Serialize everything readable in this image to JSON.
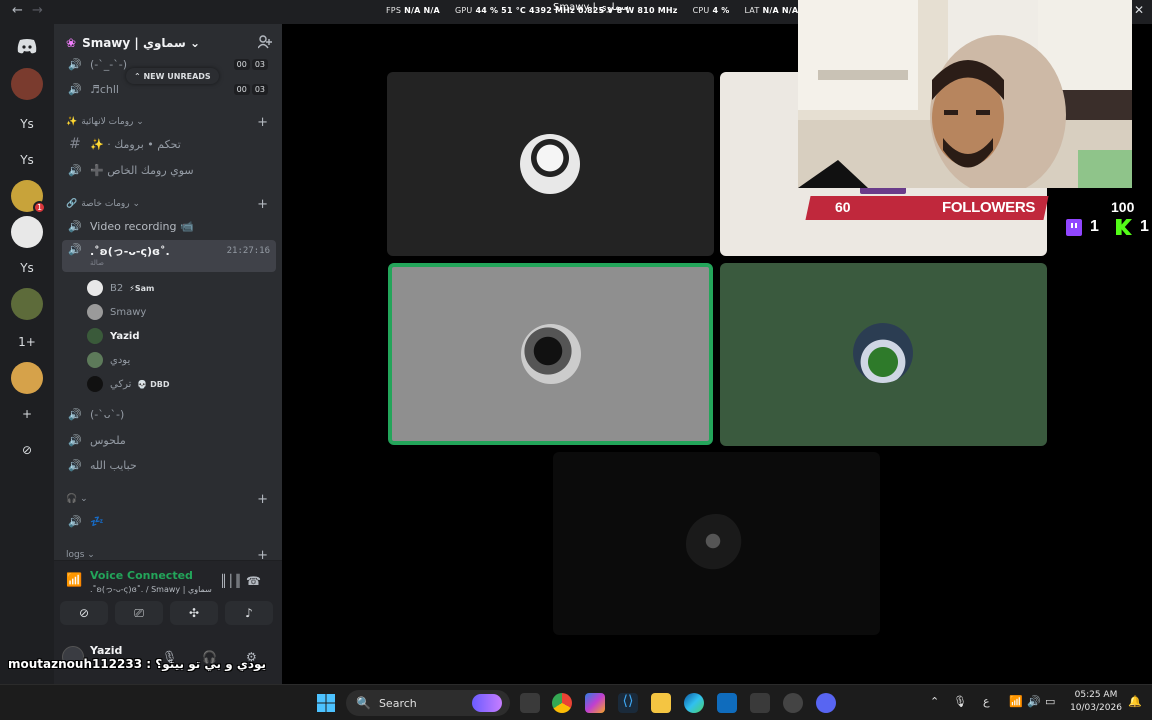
{
  "overlay": {
    "fps_label": "FPS",
    "fps_value": "N/A",
    "fps_value2": "N/A",
    "gpu_label": "GPU",
    "gpu_load": "44 %",
    "gpu_temp": "51 °C",
    "gpu_clock": "4392 MHz",
    "gpu_volt": "0.825 V",
    "gpu_power": "8 W",
    "gpu_mem": "810 MHz",
    "cpu_label": "CPU",
    "cpu_load": "4 %",
    "lat_label": "LAT",
    "lat_value": "N/A",
    "lat_value2": "N/A"
  },
  "window": {
    "title": "Smawy | سماوي",
    "back": "←",
    "forward": "→",
    "close": "✕"
  },
  "rail": {
    "home": "discord-logo",
    "items": [
      {
        "label": "",
        "kind": "avatar",
        "color": "#7a3b2e"
      },
      {
        "label": "Ys"
      },
      {
        "label": "Ys"
      },
      {
        "label": "",
        "kind": "avatar",
        "color": "#c8a33a",
        "badge": "1"
      },
      {
        "label": "",
        "kind": "avatar",
        "color": "#e8e8e8"
      },
      {
        "label": "Ys"
      },
      {
        "label": "",
        "kind": "avatar",
        "color": "#5d6b3a"
      },
      {
        "label": "1+"
      },
      {
        "label": "",
        "kind": "avatar",
        "color": "#d6a24a"
      },
      {
        "label": "+"
      },
      {
        "label": "⊘"
      }
    ]
  },
  "server": {
    "name": "Smawy | سماوي ⌄"
  },
  "channels": {
    "new_unreads": "⌃ NEW UNREADS",
    "top": [
      {
        "name": "(-`_-`-)",
        "counts": [
          "00",
          "03"
        ]
      },
      {
        "name": "♬chll",
        "counts": [
          "00",
          "03"
        ]
      }
    ],
    "cat1": "رومات لانهائية ⌄",
    "cat1_items": [
      {
        "name": "✨ · تحكم • برومك"
      },
      {
        "name": "➕ سوي رومك الخاص"
      }
    ],
    "cat2": "رومات خاصة ⌄",
    "video_recording": "Video recording 📹",
    "active_channel": ".˚ʚ(っ-ᴗ-ς)ɞ˚.",
    "active_sub": "صالة",
    "active_time": "21:27:16",
    "members": [
      {
        "name": "B2",
        "tag": "⚡Sam",
        "bright": false,
        "color": "#e8e8e8"
      },
      {
        "name": "Smawy",
        "tag": "",
        "bright": false,
        "color": "#9a9a9a"
      },
      {
        "name": "Yazid",
        "tag": "",
        "bright": true,
        "color": "#3a5a3a"
      },
      {
        "name": "يودي",
        "tag": "",
        "bright": false,
        "color": "#5d7a5a"
      },
      {
        "name": "تركي",
        "tag": "💀 DBD",
        "bright": false,
        "color": "#111111"
      }
    ],
    "more": [
      {
        "name": "(-`ᴗ`-)"
      },
      {
        "name": "ملحوس"
      },
      {
        "name": "حبايب الله"
      }
    ],
    "cat3": "🎧 ⌄",
    "cat3_item": "💤",
    "cat4": "logs ⌄"
  },
  "voice": {
    "status": "Voice Connected",
    "channel": ".˚ʚ(っ-ᴗ-ς)ɞ˚. / Smawy | سماوي",
    "buttons": [
      "camera-off",
      "screen-share",
      "activities",
      "soundboard"
    ]
  },
  "user": {
    "name": "Yazid"
  },
  "chat_overlay": "moutaznouh112233 : يودي و بي تو بيتو؟",
  "stream": {
    "followers_count": "60",
    "followers_label": "FOLLOWERS",
    "total": "100",
    "twitch": "1",
    "kick": "1"
  },
  "taskbar": {
    "search": "Search",
    "lang": "ع",
    "time": "05:25 AM",
    "date": "10/03/2026"
  },
  "colors": {
    "speaking": "#23a55a",
    "followers_bar": "#c0283c",
    "sidebar": "#2b2d31",
    "rail": "#1e1f22"
  }
}
